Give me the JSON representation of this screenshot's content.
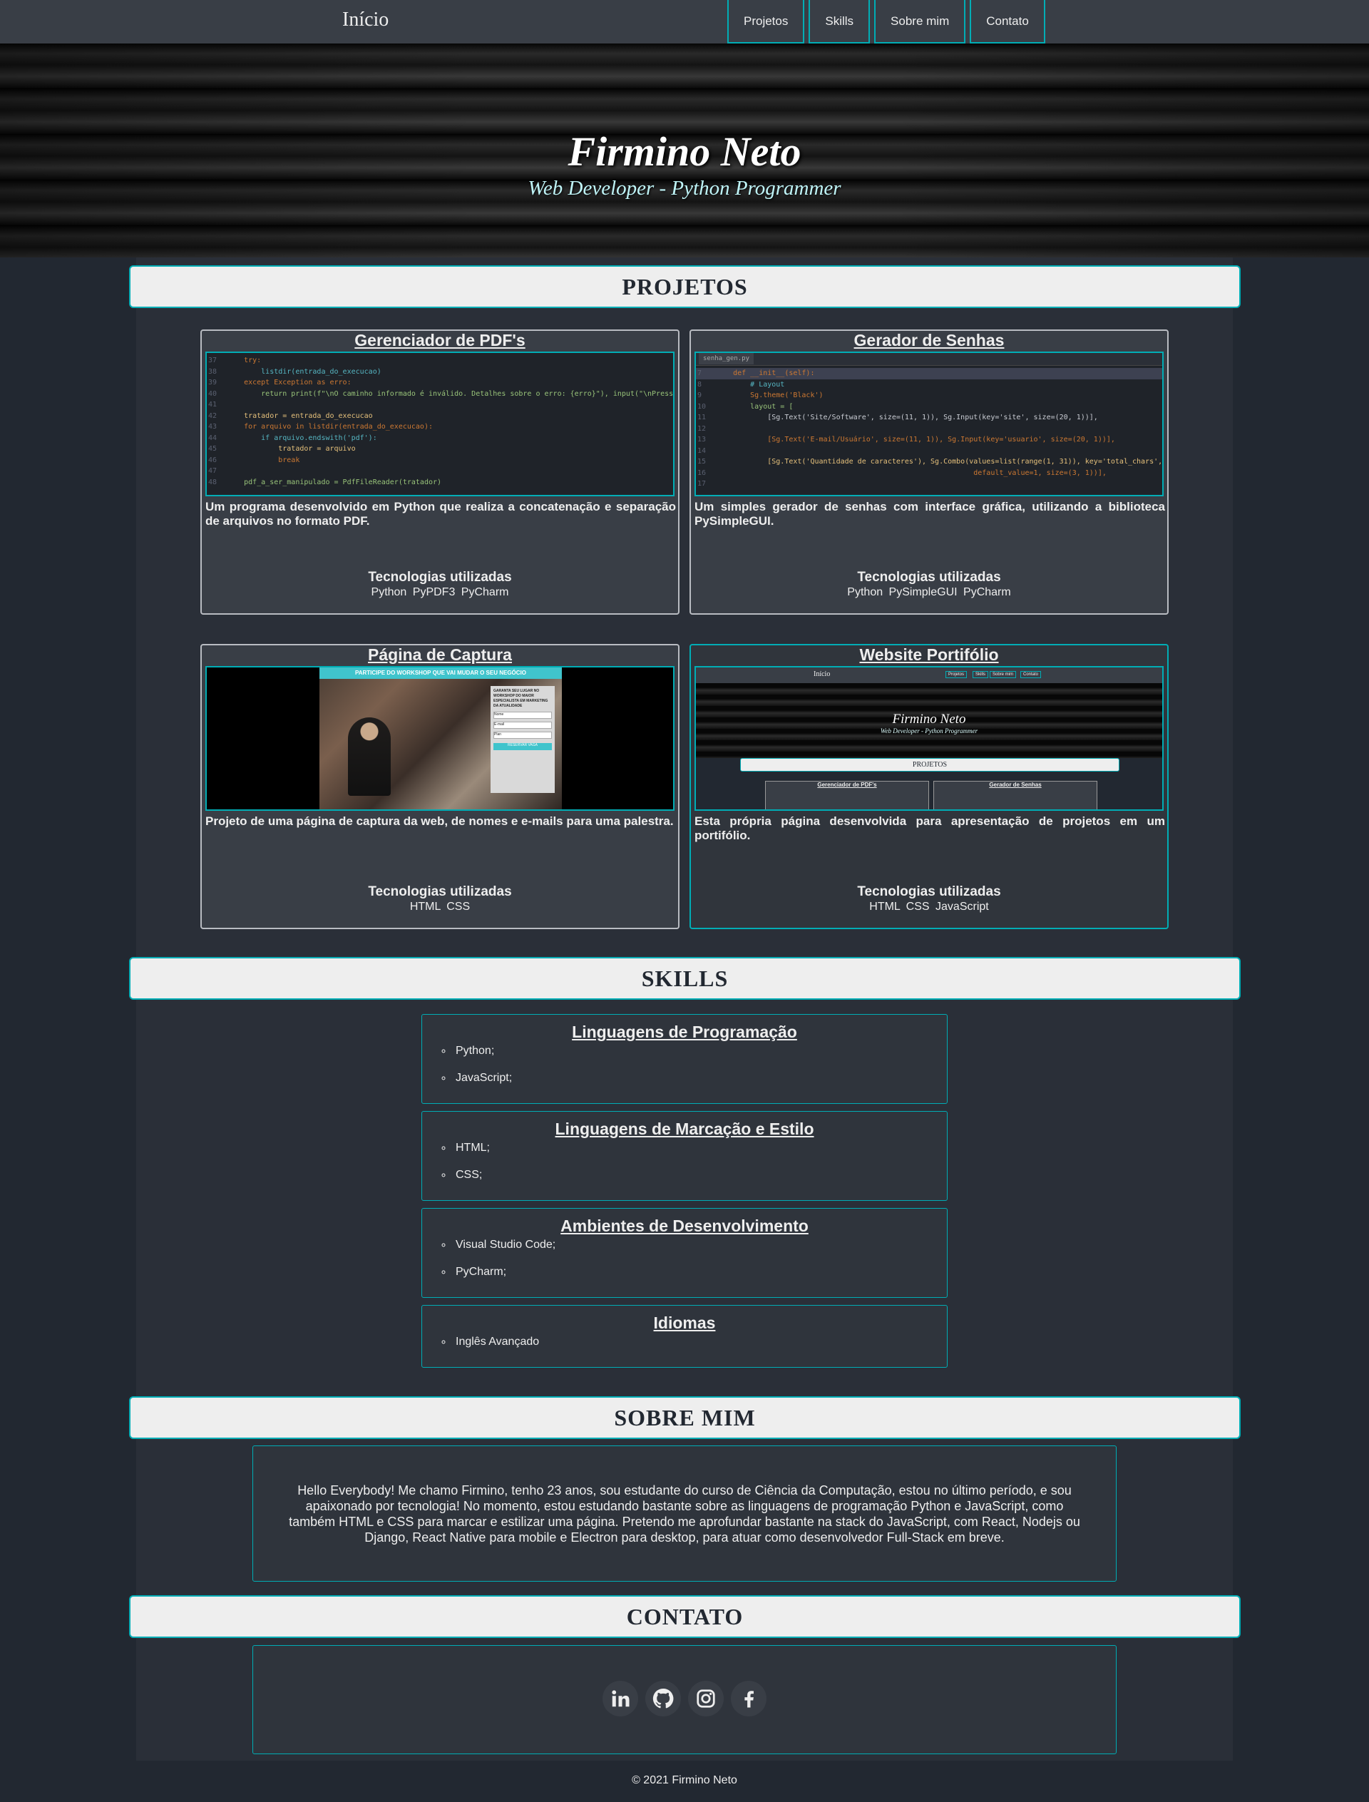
{
  "nav": {
    "brand": "Início",
    "links": [
      "Projetos",
      "Skills",
      "Sobre mim",
      "Contato"
    ]
  },
  "hero": {
    "title": "Firmino Neto",
    "subtitle": "Web Developer - Python Programmer"
  },
  "sections": {
    "projects": "PROJETOS",
    "skills": "SKILLS",
    "about": "SOBRE MIM",
    "contact": "CONTATO"
  },
  "projects": [
    {
      "title": "Gerenciador de PDF's",
      "description": "Um programa desenvolvido em Python que realiza a concatenação e separação de arquivos no formato PDF.",
      "tech_label": "Tecnologias utilizadas",
      "tech": "Python PyPDF3 PyCharm",
      "screenshot": "pdf-code-editor"
    },
    {
      "title": "Gerador de Senhas",
      "description": "Um simples gerador de senhas com interface gráfica, utilizando a biblioteca PySimpleGUI.",
      "tech_label": "Tecnologias utilizadas",
      "tech": "Python PySimpleGUI PyCharm",
      "screenshot": "password-code-editor"
    },
    {
      "title": "Página de Captura",
      "description": "Projeto de uma página de captura da web, de nomes e e-mails para uma palestra.",
      "tech_label": "Tecnologias utilizadas",
      "tech": "HTML CSS",
      "screenshot": "capture-page"
    },
    {
      "title": "Website Portifólio",
      "description": "Esta própria página desenvolvida para apresentação de projetos em um portifólio.",
      "tech_label": "Tecnologias utilizadas",
      "tech": "HTML CSS JavaScript",
      "screenshot": "portfolio-page"
    }
  ],
  "shots": {
    "pdf": {
      "line_numbers": [
        "37",
        "38",
        "39",
        "40",
        "41",
        "42",
        "43",
        "44",
        "45",
        "46",
        "47",
        "48"
      ],
      "code": [
        "try:",
        "    listdir(entrada_do_execucao)",
        "except Exception as erro:",
        "    return print(f\"\\nO caminho informado é inválido. Detalhes sobre o erro: {erro}\"), input(\"\\nPressione 'enter' par",
        "",
        "tratador = entrada_do_execucao",
        "for arquivo in listdir(entrada_do_execucao):",
        "    if arquivo.endswith('pdf'):",
        "        tratador = arquivo",
        "        break",
        "",
        "pdf_a_ser_manipulado = PdfFileReader(tratador)"
      ]
    },
    "senhas": {
      "tab": "senha_gen.py",
      "line_numbers": [
        "7",
        "8",
        "9",
        "10",
        "11",
        "12",
        "13",
        "14",
        "15",
        "16",
        "17"
      ],
      "code": [
        "def __init__(self):",
        "    # Layout",
        "    Sg.theme('Black')",
        "    layout = [",
        "        [Sg.Text('Site/Software', size=(11, 1)), Sg.Input(key='site', size=(20, 1))],",
        "",
        "        [Sg.Text('E-mail/Usuário', size=(11, 1)), Sg.Input(key='usuario', size=(20, 1))],",
        "",
        "        [Sg.Text('Quantidade de caracteres'), Sg.Combo(values=list(range(1, 31)), key='total_chars',",
        "                                                        default_value=1, size=(3, 1))],",
        ""
      ]
    },
    "capture": {
      "banner": "PARTICIPE DO WORKSHOP QUE VAI MUDAR O SEU NEGÓCIO",
      "form_heading": "GARANTA SEU LUGAR NO WORKSHOP DO MAIOR ESPECIALISTA EM MARKETING DA ATUALIDADE",
      "field_name": "Nome",
      "field_email": "E-mail",
      "field_select": "Plan",
      "button": "RESERVAR VAGA"
    },
    "portfolio": {
      "brand": "Início",
      "links": [
        "Projetos",
        "Skills",
        "Sobre mim",
        "Contato"
      ],
      "title": "Firmino Neto",
      "subtitle": "Web Developer - Python Programmer",
      "section": "PROJETOS",
      "card1": "Gerenciador de PDF's",
      "card2": "Gerador de Senhas"
    }
  },
  "skills": [
    {
      "title": "Linguagens de Programação",
      "items": [
        "Python;",
        "JavaScript;"
      ]
    },
    {
      "title": "Linguagens de Marcação e Estilo",
      "items": [
        "HTML;",
        "CSS;"
      ]
    },
    {
      "title": "Ambientes de Desenvolvimento",
      "items": [
        "Visual Studio Code;",
        "PyCharm;"
      ]
    },
    {
      "title": "Idiomas",
      "items": [
        "Inglês Avançado"
      ]
    }
  ],
  "about": {
    "text": "Hello Everybody! Me chamo Firmino, tenho 23 anos, sou estudante do curso de Ciência da Computação, estou no último período, e sou apaixonado por tecnologia! No momento, estou estudando bastante sobre as linguagens de programação Python e JavaScript, como também HTML e CSS para marcar e estilizar uma página. Pretendo me aprofundar bastante na stack do JavaScript, com React, Nodejs ou Django, React Native para mobile e Electron para desktop, para atuar como desenvolvedor Full-Stack em breve."
  },
  "contact": {
    "icons": [
      "linkedin-icon",
      "github-icon",
      "instagram-icon",
      "facebook-icon"
    ]
  },
  "footer": "© 2021 Firmino Neto",
  "colors": {
    "accent": "#00adb5",
    "background": "#222831",
    "card": "#393e46",
    "text": "#eeeeee"
  }
}
